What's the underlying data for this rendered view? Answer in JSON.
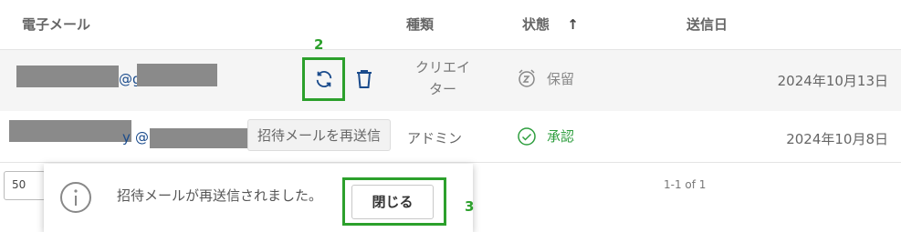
{
  "table": {
    "headers": {
      "email": "電子メール",
      "type": "種類",
      "status": "状態",
      "sort_indicator": "↑",
      "sent": "送信日"
    },
    "rows": [
      {
        "email_visible": "@g",
        "type": "クリエイター",
        "type_line1": "クリエイ",
        "type_line2": "ター",
        "status": "保留",
        "status_icon": "alarm-clock-icon",
        "date": "2024年10月13日"
      },
      {
        "email_visible_a": "y",
        "email_visible_b": "@",
        "type": "アドミン",
        "status": "承認",
        "status_icon": "check-circle-icon",
        "date": "2024年10月8日"
      }
    ]
  },
  "row_actions": {
    "resend_icon": "refresh-icon",
    "delete_icon": "trash-icon",
    "tooltip": "招待メールを再送信"
  },
  "pagination": {
    "page_size": "50",
    "range": "1-1 of 1"
  },
  "snackbar": {
    "icon": "info-icon",
    "message": "招待メールが再送信されました。",
    "close_label": "閉じる"
  },
  "annotations": {
    "step2": "2",
    "step3": "3",
    "color": "#2ca02c"
  },
  "colors": {
    "link": "#1a4b8c",
    "approved": "#2e9e3e",
    "pending": "#888888"
  }
}
